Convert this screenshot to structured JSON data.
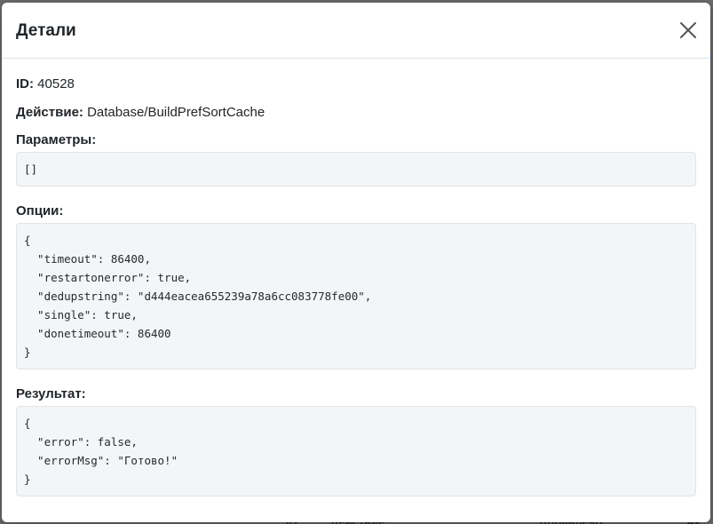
{
  "modal": {
    "title": "Детали",
    "close_icon": "close-icon"
  },
  "details": {
    "id_label": "ID:",
    "id_value": "40528",
    "action_label": "Действие:",
    "action_value": "Database/BuildPrefSortCache",
    "params_label": "Параметры:",
    "params_value": "[]",
    "options_label": "Опции:",
    "options_value": "{\n  \"timeout\": 86400,\n  \"restartonerror\": true,\n  \"dedupstring\": \"d444eacea655239a78a6cc083778fe00\",\n  \"single\": true,\n  \"donetimeout\": 86400\n}",
    "result_label": "Результат:",
    "result_value": "{\n  \"error\": false,\n  \"errorMsg\": \"Готово!\"\n}"
  },
  "background": {
    "bottom_col_1": "ID",
    "bottom_col_2": "Действие",
    "bottom_col_3": "Добавлено",
    "bottom_col_4": "Ак"
  },
  "colors": {
    "overlay": "#5f6062",
    "modal_bg": "#ffffff",
    "code_bg": "#f4f5f6",
    "border": "#dee2e6"
  }
}
